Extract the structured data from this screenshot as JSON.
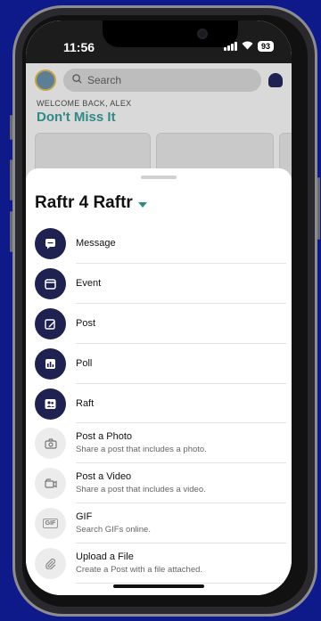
{
  "status": {
    "time": "11:56",
    "battery": "93"
  },
  "background": {
    "search_placeholder": "Search",
    "welcome": "WELCOME BACK, ALEX",
    "headline": "Don't Miss It"
  },
  "sheet": {
    "title": "Raftr 4 Raftr",
    "items": [
      {
        "label": "Message",
        "icon": "message-icon"
      },
      {
        "label": "Event",
        "icon": "calendar-icon"
      },
      {
        "label": "Post",
        "icon": "post-edit-icon"
      },
      {
        "label": "Poll",
        "icon": "poll-chart-icon"
      },
      {
        "label": "Raft",
        "icon": "group-icon"
      },
      {
        "label": "Post a Photo",
        "sub": "Share a post that includes a photo.",
        "icon": "camera-icon"
      },
      {
        "label": "Post a Video",
        "sub": "Share a post that includes a video.",
        "icon": "video-icon"
      },
      {
        "label": "GIF",
        "sub": "Search GIFs online.",
        "icon": "gif-icon",
        "icon_text": "GIF"
      },
      {
        "label": "Upload a File",
        "sub": "Create a Post with a file attached.",
        "icon": "paperclip-icon"
      }
    ]
  },
  "colors": {
    "accent": "#2f8a86",
    "dark_circle": "#1f2250",
    "page_bg": "#0f1a8a"
  }
}
